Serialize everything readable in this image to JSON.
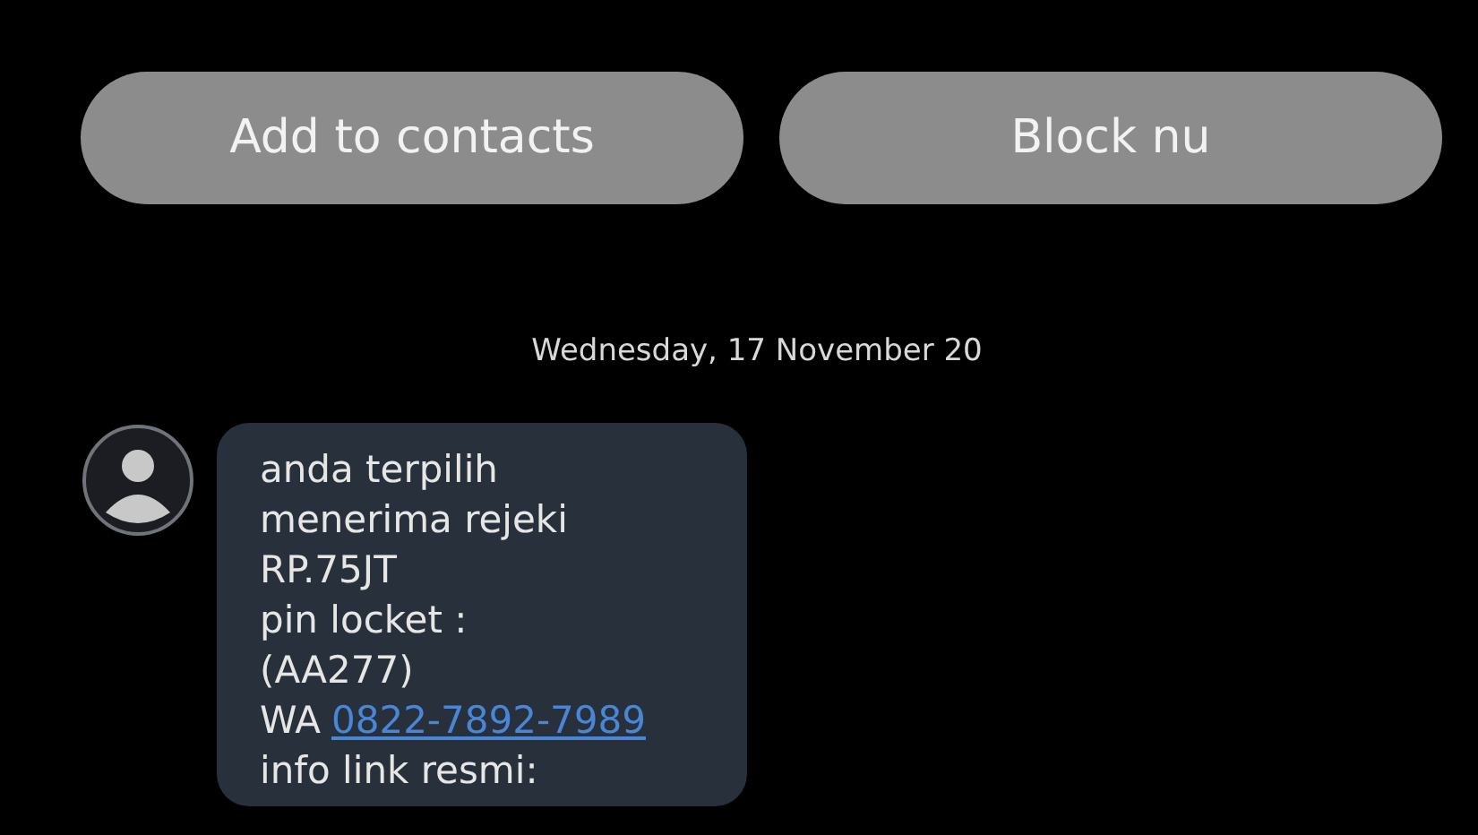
{
  "buttons": [
    {
      "label": "Add to contacts"
    },
    {
      "label": "Block nu"
    }
  ],
  "date": "Wednesday, 17 November 20",
  "message": {
    "lines": [
      {
        "kind": "text",
        "text": "anda terpilih"
      },
      {
        "kind": "text",
        "text": "menerima rejeki"
      },
      {
        "kind": "text",
        "text": "RP.75JT"
      },
      {
        "kind": "text",
        "text": "pin locket :"
      },
      {
        "kind": "text",
        "text": "(AA277)"
      },
      {
        "kind": "link",
        "prefix": "WA",
        "text": "0822-7892-7989"
      },
      {
        "kind": "text",
        "text": "info link resmi:"
      }
    ]
  }
}
